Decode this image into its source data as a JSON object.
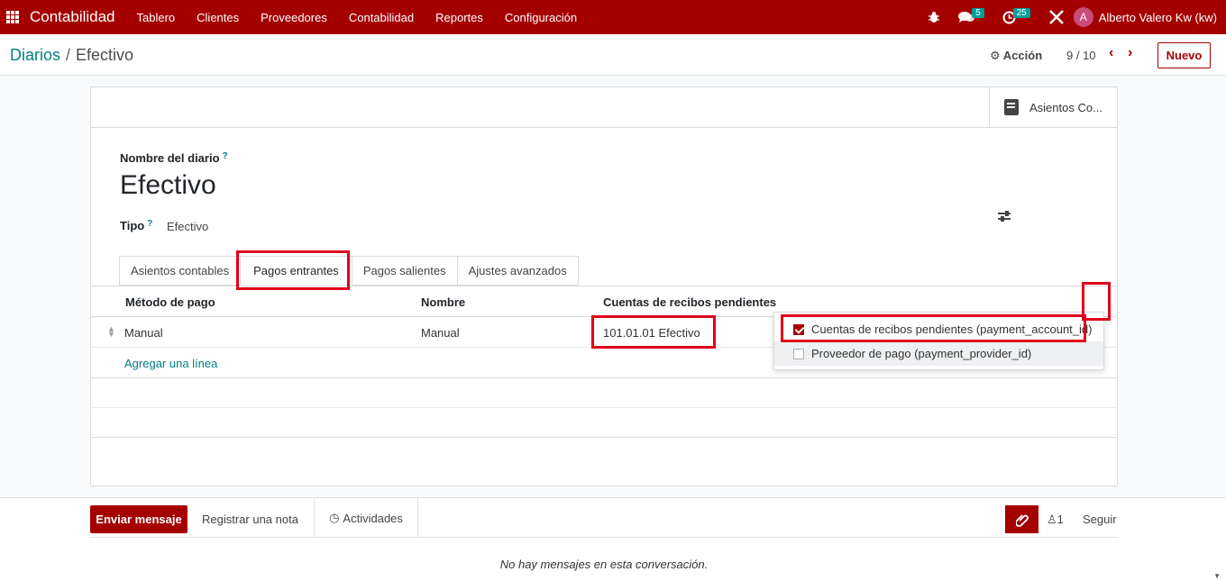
{
  "navbar": {
    "brand": "Contabilidad",
    "menu": [
      "Tablero",
      "Clientes",
      "Proveedores",
      "Contabilidad",
      "Reportes",
      "Configuración"
    ],
    "messages_count": "5",
    "activities_count": "25",
    "user_initial": "A",
    "user_name": "Alberto Valero Kw (kw)"
  },
  "breadcrumb": {
    "parent": "Diarios",
    "separator": "/",
    "current": "Efectivo"
  },
  "control": {
    "action_label": "Acción",
    "pager": "9 / 10",
    "new_label": "Nuevo"
  },
  "smart_button": {
    "label": "Asientos Co..."
  },
  "form": {
    "name_label": "Nombre del diario",
    "help": "?",
    "name_value": "Efectivo",
    "type_label": "Tipo",
    "type_value": "Efectivo"
  },
  "tabs": [
    "Asientos contables",
    "Pagos entrantes",
    "Pagos salientes",
    "Ajustes avanzados"
  ],
  "table": {
    "headers": [
      "Método de pago",
      "Nombre",
      "Cuentas de recibos pendientes"
    ],
    "rows": [
      [
        "Manual",
        "Manual",
        "101.01.01 Efectivo"
      ]
    ],
    "add_line": "Agregar una línea"
  },
  "column_menu": {
    "items": [
      {
        "label": "Cuentas de recibos pendientes (payment_account_id)",
        "checked": true
      },
      {
        "label": "Proveedor de pago (payment_provider_id)",
        "checked": false
      }
    ]
  },
  "chatter": {
    "send_label": "Enviar mensaje",
    "note_label": "Registrar una nota",
    "activities_label": "Actividades",
    "followers_count": "1",
    "follow_label": "Seguir",
    "empty_text": "No hay mensajes en esta conversación."
  },
  "colors": {
    "brand": "#a50000",
    "link": "#017e84",
    "highlight": "#e0001b"
  }
}
